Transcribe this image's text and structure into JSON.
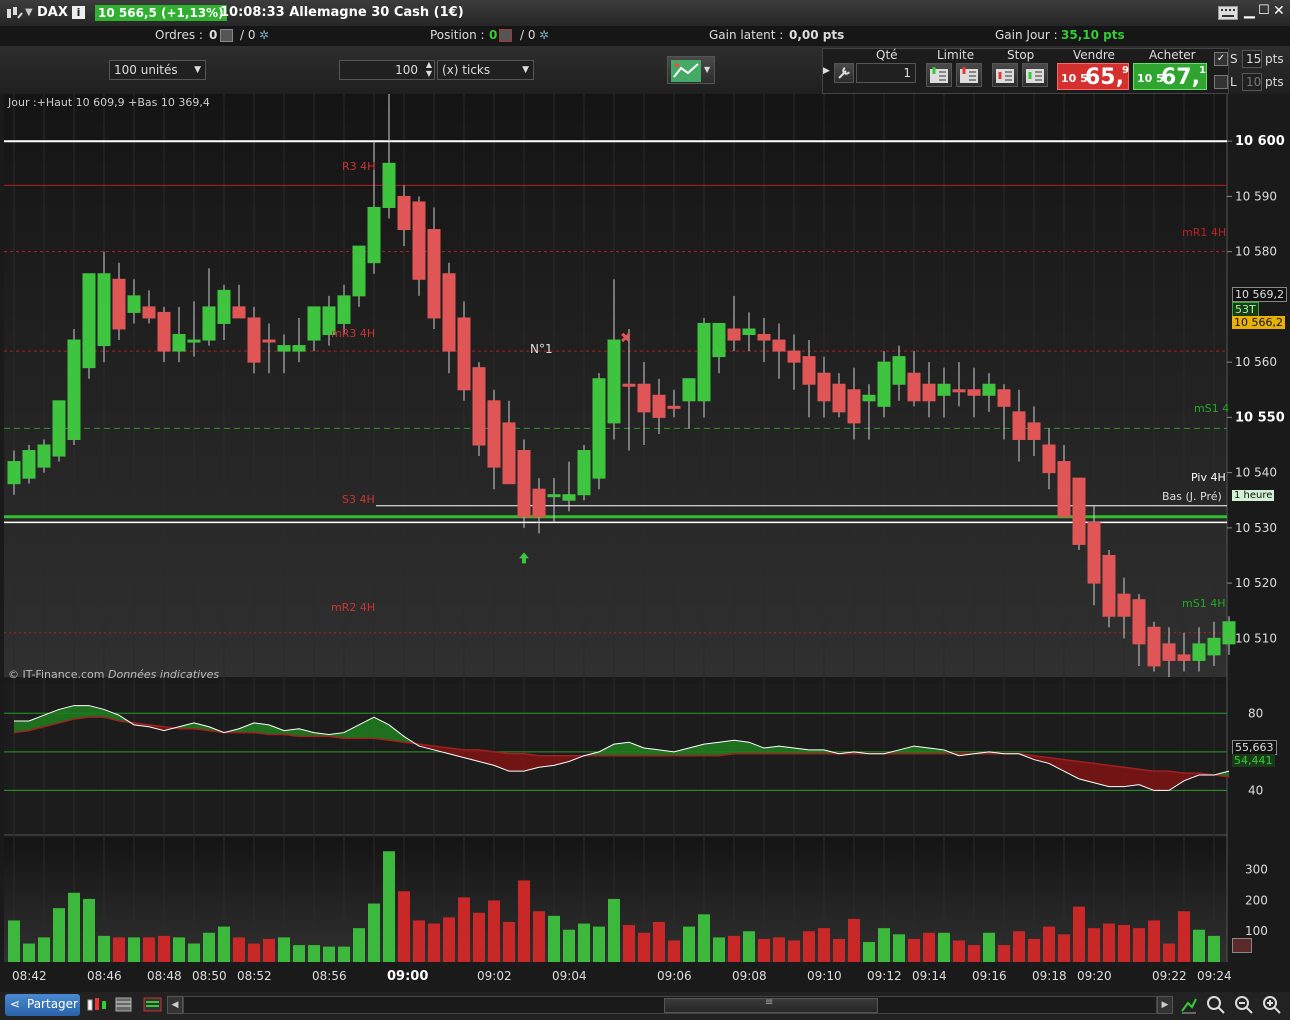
{
  "titlebar": {
    "instrument": "DAX",
    "price_change": "10 566,5 (+1,13%)",
    "time_title": "10:08:33 Allemagne 30 Cash (1€)"
  },
  "infobar": {
    "orders_label": "Ordres :",
    "orders_count": "0",
    "orders_slash": "/ 0",
    "position_label": "Position :",
    "position_count": "0",
    "position_slash": "/ 0",
    "gain_latent_label": "Gain latent :",
    "gain_latent_value": "0,00 pts",
    "gain_jour_label": "Gain Jour :",
    "gain_jour_value": "35,10 pts"
  },
  "toolbar": {
    "units_select": "100 unités",
    "ticks_value": "100",
    "ticks_select": "(x) ticks",
    "qty_label": "Qté",
    "qty_value": "1",
    "limit_label": "Limite",
    "stop_label": "Stop",
    "sell_label": "Vendre",
    "buy_label": "Acheter",
    "sell_prefix": "10 5",
    "sell_big": "65,",
    "sell_sup": "9",
    "buy_prefix": "10 5",
    "buy_big": "67,",
    "buy_sup": "1",
    "s_label": "S",
    "s_value": "15",
    "s_unit": "pts",
    "l_label": "L",
    "l_value": "10",
    "l_unit": "pts"
  },
  "chart_header": "Jour :+Haut 10 609,9 +Bas 10 369,4",
  "watermark_source": "© IT-Finance.com",
  "watermark_note": "Données indicatives",
  "annotation_label": "N°1",
  "level_labels": {
    "r3": "R3 4H",
    "mr1": "mR1 4H",
    "mr3": "mR3 4H",
    "mS1": "mS1 4",
    "piv": "Piv 4H",
    "bas": "Bas (J. Pré)",
    "s3": "S3 4H",
    "mr2": "mR2 4H",
    "ms1b": "mS1 4H"
  },
  "price_axis": [
    "10 600",
    "10 590",
    "10 580",
    "10 560",
    "10 550",
    "10 540",
    "10 530",
    "10 520",
    "10 510"
  ],
  "price_axis_570": "10 569,2",
  "price_tags": {
    "ticks": "53T",
    "current": "10 566,2",
    "timeframe": "1 heure"
  },
  "osc_axis": [
    "80",
    "40"
  ],
  "osc_tags": {
    "a": "55,663",
    "b": "54,441"
  },
  "vol_axis": [
    "300",
    "200",
    "100"
  ],
  "time_axis": [
    "08:42",
    "08:46",
    "08:48",
    "08:50",
    "08:52",
    "08:56",
    "09:00",
    "09:02",
    "09:04",
    "09:06",
    "09:08",
    "09:10",
    "09:12",
    "09:14",
    "09:16",
    "09:18",
    "09:20",
    "09:22",
    "09:24"
  ],
  "bottombar": {
    "share_label": "Partager"
  },
  "colors": {
    "up": "#3fc43f",
    "down": "#e05656",
    "vol_up": "#3cb83c",
    "vol_down": "#c82828"
  },
  "chart_data": [
    {
      "type": "candlestick",
      "title": "",
      "ylim": [
        10503,
        10608
      ],
      "candles": [
        {
          "o": 10538,
          "h": 10544,
          "l": 10536,
          "c": 10542,
          "up": true
        },
        {
          "o": 10539,
          "h": 10545,
          "l": 10538,
          "c": 10544,
          "up": true
        },
        {
          "o": 10541,
          "h": 10546,
          "l": 10540,
          "c": 10545,
          "up": true
        },
        {
          "o": 10543,
          "h": 10551,
          "l": 10542,
          "c": 10553,
          "up": true
        },
        {
          "o": 10546,
          "h": 10566,
          "l": 10545,
          "c": 10564,
          "up": true
        },
        {
          "o": 10559,
          "h": 10574,
          "l": 10557,
          "c": 10576,
          "up": true
        },
        {
          "o": 10563,
          "h": 10580,
          "l": 10560,
          "c": 10576,
          "up": true
        },
        {
          "o": 10575,
          "h": 10578,
          "l": 10564,
          "c": 10566,
          "up": false
        },
        {
          "o": 10569,
          "h": 10575,
          "l": 10567,
          "c": 10572,
          "up": true
        },
        {
          "o": 10570,
          "h": 10573,
          "l": 10567,
          "c": 10568,
          "up": false
        },
        {
          "o": 10569,
          "h": 10570,
          "l": 10560,
          "c": 10562,
          "up": false
        },
        {
          "o": 10562,
          "h": 10570,
          "l": 10560,
          "c": 10565,
          "up": true
        },
        {
          "o": 10564,
          "h": 10571,
          "l": 10561,
          "c": 10564,
          "up": true
        },
        {
          "o": 10570,
          "h": 10577,
          "l": 10563,
          "c": 10564,
          "up": true
        },
        {
          "o": 10567,
          "h": 10574,
          "l": 10564,
          "c": 10573,
          "up": true
        },
        {
          "o": 10570,
          "h": 10574,
          "l": 10568,
          "c": 10568,
          "up": false
        },
        {
          "o": 10568,
          "h": 10570,
          "l": 10558,
          "c": 10560,
          "up": false
        },
        {
          "o": 10564,
          "h": 10567,
          "l": 10558,
          "c": 10564,
          "up": false
        },
        {
          "o": 10563,
          "h": 10565,
          "l": 10558,
          "c": 10562,
          "up": true
        },
        {
          "o": 10562,
          "h": 10568,
          "l": 10560,
          "c": 10563,
          "up": true
        },
        {
          "o": 10564,
          "h": 10570,
          "l": 10562,
          "c": 10570,
          "up": true
        },
        {
          "o": 10565,
          "h": 10572,
          "l": 10563,
          "c": 10570,
          "up": true
        },
        {
          "o": 10567,
          "h": 10574,
          "l": 10565,
          "c": 10572,
          "up": true
        },
        {
          "o": 10572,
          "h": 10578,
          "l": 10570,
          "c": 10581,
          "up": true
        },
        {
          "o": 10578,
          "h": 10600,
          "l": 10576,
          "c": 10588,
          "up": true
        },
        {
          "o": 10588,
          "h": 10610,
          "l": 10586,
          "c": 10596,
          "up": true
        },
        {
          "o": 10590,
          "h": 10592,
          "l": 10581,
          "c": 10584,
          "up": false
        },
        {
          "o": 10589,
          "h": 10590,
          "l": 10572,
          "c": 10575,
          "up": false
        },
        {
          "o": 10584,
          "h": 10588,
          "l": 10566,
          "c": 10568,
          "up": false
        },
        {
          "o": 10576,
          "h": 10578,
          "l": 10558,
          "c": 10562,
          "up": false
        },
        {
          "o": 10568,
          "h": 10571,
          "l": 10553,
          "c": 10555,
          "up": false
        },
        {
          "o": 10559,
          "h": 10560,
          "l": 10543,
          "c": 10545,
          "up": false
        },
        {
          "o": 10553,
          "h": 10555,
          "l": 10537,
          "c": 10541,
          "up": false
        },
        {
          "o": 10549,
          "h": 10553,
          "l": 10538,
          "c": 10538,
          "up": false
        },
        {
          "o": 10544,
          "h": 10546,
          "l": 10530,
          "c": 10532,
          "up": false
        },
        {
          "o": 10537,
          "h": 10539,
          "l": 10529,
          "c": 10532,
          "up": false
        },
        {
          "o": 10536,
          "h": 10539,
          "l": 10531,
          "c": 10536,
          "up": true
        },
        {
          "o": 10536,
          "h": 10542,
          "l": 10533,
          "c": 10535,
          "up": true
        },
        {
          "o": 10536,
          "h": 10545,
          "l": 10535,
          "c": 10544,
          "up": true
        },
        {
          "o": 10539,
          "h": 10558,
          "l": 10537,
          "c": 10557,
          "up": true
        },
        {
          "o": 10549,
          "h": 10575,
          "l": 10546,
          "c": 10564,
          "up": true
        },
        {
          "o": 10556,
          "h": 10566,
          "l": 10544,
          "c": 10556,
          "up": false
        },
        {
          "o": 10556,
          "h": 10560,
          "l": 10545,
          "c": 10551,
          "up": false
        },
        {
          "o": 10554,
          "h": 10557,
          "l": 10547,
          "c": 10550,
          "up": false
        },
        {
          "o": 10552,
          "h": 10555,
          "l": 10550,
          "c": 10552,
          "up": false
        },
        {
          "o": 10553,
          "h": 10557,
          "l": 10548,
          "c": 10557,
          "up": true
        },
        {
          "o": 10553,
          "h": 10568,
          "l": 10550,
          "c": 10567,
          "up": true
        },
        {
          "o": 10561,
          "h": 10567,
          "l": 10558,
          "c": 10567,
          "up": true
        },
        {
          "o": 10566,
          "h": 10572,
          "l": 10562,
          "c": 10564,
          "up": false
        },
        {
          "o": 10566,
          "h": 10569,
          "l": 10562,
          "c": 10565,
          "up": true
        },
        {
          "o": 10565,
          "h": 10568,
          "l": 10560,
          "c": 10564,
          "up": false
        },
        {
          "o": 10564,
          "h": 10567,
          "l": 10557,
          "c": 10562,
          "up": false
        },
        {
          "o": 10562,
          "h": 10565,
          "l": 10555,
          "c": 10560,
          "up": false
        },
        {
          "o": 10561,
          "h": 10564,
          "l": 10550,
          "c": 10556,
          "up": false
        },
        {
          "o": 10558,
          "h": 10561,
          "l": 10550,
          "c": 10553,
          "up": false
        },
        {
          "o": 10556,
          "h": 10558,
          "l": 10550,
          "c": 10551,
          "up": false
        },
        {
          "o": 10555,
          "h": 10559,
          "l": 10546,
          "c": 10549,
          "up": false
        },
        {
          "o": 10553,
          "h": 10556,
          "l": 10546,
          "c": 10554,
          "up": true
        },
        {
          "o": 10552,
          "h": 10562,
          "l": 10550,
          "c": 10560,
          "up": true
        },
        {
          "o": 10556,
          "h": 10563,
          "l": 10553,
          "c": 10561,
          "up": true
        },
        {
          "o": 10558,
          "h": 10562,
          "l": 10552,
          "c": 10553,
          "up": false
        },
        {
          "o": 10556,
          "h": 10560,
          "l": 10550,
          "c": 10553,
          "up": false
        },
        {
          "o": 10554,
          "h": 10559,
          "l": 10550,
          "c": 10556,
          "up": true
        },
        {
          "o": 10555,
          "h": 10560,
          "l": 10552,
          "c": 10555,
          "up": false
        },
        {
          "o": 10555,
          "h": 10559,
          "l": 10550,
          "c": 10554,
          "up": false
        },
        {
          "o": 10554,
          "h": 10558,
          "l": 10551,
          "c": 10556,
          "up": true
        },
        {
          "o": 10555,
          "h": 10556,
          "l": 10546,
          "c": 10552,
          "up": false
        },
        {
          "o": 10551,
          "h": 10555,
          "l": 10542,
          "c": 10546,
          "up": false
        },
        {
          "o": 10549,
          "h": 10552,
          "l": 10543,
          "c": 10546,
          "up": false
        },
        {
          "o": 10545,
          "h": 10548,
          "l": 10537,
          "c": 10540,
          "up": false
        },
        {
          "o": 10542,
          "h": 10545,
          "l": 10535,
          "c": 10532,
          "up": false
        },
        {
          "o": 10539,
          "h": 10539,
          "l": 10526,
          "c": 10527,
          "up": false
        },
        {
          "o": 10531,
          "h": 10534,
          "l": 10516,
          "c": 10520,
          "up": false
        },
        {
          "o": 10525,
          "h": 10526,
          "l": 10512,
          "c": 10514,
          "up": false
        },
        {
          "o": 10518,
          "h": 10521,
          "l": 10510,
          "c": 10514,
          "up": false
        },
        {
          "o": 10517,
          "h": 10518,
          "l": 10505,
          "c": 10509,
          "up": false
        },
        {
          "o": 10512,
          "h": 10513,
          "l": 10504,
          "c": 10505,
          "up": false
        },
        {
          "o": 10509,
          "h": 10512,
          "l": 10503,
          "c": 10506,
          "up": false
        },
        {
          "o": 10507,
          "h": 10511,
          "l": 10504,
          "c": 10506,
          "up": false
        },
        {
          "o": 10506,
          "h": 10512,
          "l": 10504,
          "c": 10509,
          "up": true
        },
        {
          "o": 10507,
          "h": 10513,
          "l": 10505,
          "c": 10510,
          "up": true
        },
        {
          "o": 10509,
          "h": 10514,
          "l": 10507,
          "c": 10513,
          "up": true
        }
      ],
      "levels": [
        10600,
        10592,
        10580,
        10562,
        10548,
        10534,
        10532,
        10531,
        10511
      ]
    },
    {
      "type": "area",
      "ylim": [
        20,
        90
      ],
      "x_count": 82,
      "series": [
        {
          "values": [
            76,
            76,
            79,
            82,
            84,
            84,
            82,
            79,
            74,
            73,
            71,
            73,
            75,
            73,
            70,
            72,
            75,
            74,
            71,
            72,
            70,
            69,
            70,
            74,
            78,
            74,
            68,
            63,
            61,
            59,
            57,
            55,
            53,
            50,
            50,
            52,
            53,
            55,
            58,
            60,
            64,
            65,
            62,
            61,
            60,
            62,
            64,
            65,
            66,
            65,
            62,
            63,
            62,
            61,
            61,
            59,
            60,
            59,
            59,
            61,
            63,
            62,
            61,
            58,
            59,
            60,
            59,
            59,
            56,
            54,
            50,
            46,
            44,
            42,
            42,
            43,
            40,
            40,
            45,
            48,
            48,
            50
          ]
        },
        {
          "values": [
            70,
            71,
            73,
            75,
            77,
            78,
            78,
            76,
            75,
            74,
            73,
            72,
            72,
            71,
            70,
            70,
            70,
            69,
            69,
            68,
            68,
            68,
            67,
            67,
            67,
            66,
            65,
            64,
            63,
            62,
            61,
            61,
            60,
            59,
            59,
            58,
            58,
            58,
            58,
            58,
            58,
            58,
            58,
            58,
            58,
            58,
            58,
            58,
            59,
            59,
            59,
            59,
            59,
            59,
            59,
            59,
            59,
            59,
            59,
            59,
            59,
            59,
            59,
            59,
            59,
            59,
            59,
            59,
            58,
            57,
            56,
            55,
            54,
            53,
            52,
            51,
            50,
            50,
            49,
            49,
            48,
            47
          ]
        }
      ],
      "hlines": [
        80,
        60,
        40
      ]
    },
    {
      "type": "bar",
      "ylim": [
        0,
        390
      ],
      "values": [
        135,
        60,
        80,
        175,
        225,
        205,
        85,
        80,
        80,
        80,
        85,
        80,
        60,
        95,
        115,
        80,
        60,
        75,
        80,
        55,
        55,
        50,
        50,
        110,
        190,
        360,
        230,
        135,
        125,
        145,
        210,
        160,
        200,
        130,
        265,
        165,
        150,
        105,
        125,
        115,
        205,
        120,
        95,
        130,
        70,
        115,
        155,
        80,
        85,
        100,
        75,
        80,
        70,
        100,
        110,
        75,
        140,
        65,
        110,
        90,
        75,
        95,
        95,
        70,
        55,
        95,
        55,
        100,
        75,
        115,
        90,
        180,
        110,
        125,
        120,
        110,
        135,
        60,
        165,
        105,
        85
      ]
    }
  ]
}
